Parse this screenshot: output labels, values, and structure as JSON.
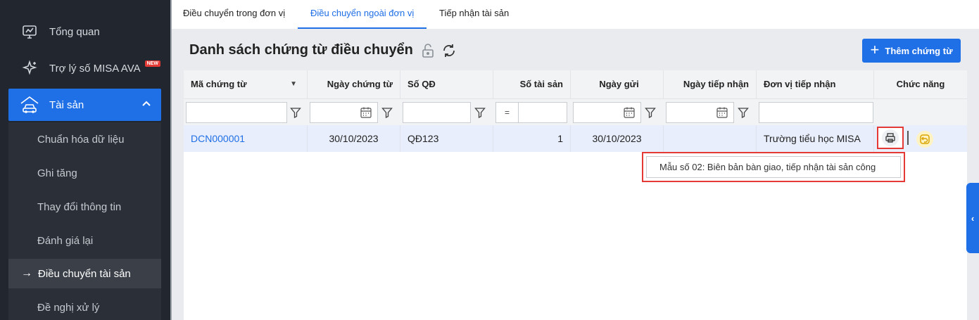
{
  "sidebar": {
    "items": [
      {
        "label": "Tổng quan",
        "icon": "dashboard-icon"
      },
      {
        "label": "Trợ lý số MISA AVA",
        "icon": "sparkle-icon",
        "badge": "NEW"
      },
      {
        "label": "Tài sản",
        "icon": "car-home-icon",
        "active": true
      }
    ],
    "submenu": [
      {
        "label": "Chuẩn hóa dữ liệu"
      },
      {
        "label": "Ghi tăng"
      },
      {
        "label": "Thay đổi thông tin"
      },
      {
        "label": "Đánh giá lại"
      },
      {
        "label": "Điều chuyển tài sản",
        "active": true
      },
      {
        "label": "Đề nghị xử lý"
      }
    ]
  },
  "tabs": [
    {
      "label": "Điều chuyển trong đơn vị"
    },
    {
      "label": "Điều chuyển ngoài đơn vị",
      "active": true
    },
    {
      "label": "Tiếp nhận tài sản"
    }
  ],
  "page": {
    "title": "Danh sách chứng từ điều chuyển",
    "add_button": "Thêm chứng từ"
  },
  "table": {
    "headers": [
      "Mã chứng từ",
      "Ngày chứng từ",
      "Số QĐ",
      "Số tài sản",
      "Ngày gửi",
      "Ngày tiếp nhận",
      "Đơn vị tiếp nhận",
      "Chức năng"
    ],
    "filter_operator": "=",
    "rows": [
      {
        "ma": "DCN000001",
        "ngay": "30/10/2023",
        "so_qd": "QĐ123",
        "so_ts": "1",
        "ngay_gui": "30/10/2023",
        "ngay_tn": "",
        "don_vi": "Trường tiểu học MISA"
      }
    ]
  },
  "tooltip": {
    "text": "Mẫu số 02: Biên bản bàn giao, tiếp nhận tài sản công"
  },
  "colors": {
    "accent": "#1f6fe6",
    "sidebar": "#22262e",
    "highlight": "#e53935"
  }
}
